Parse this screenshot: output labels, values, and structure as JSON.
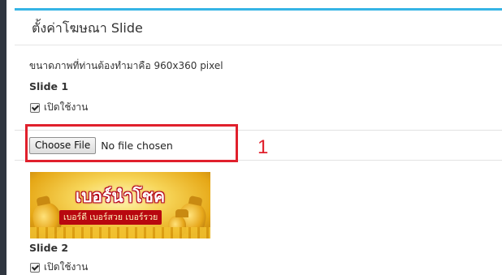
{
  "panel": {
    "title": "ตั้งค่าโฆษณา Slide",
    "size_hint": "ขนาดภาพที่ท่านต้องทำมาคือ 960x360 pixel"
  },
  "slides": [
    {
      "heading": "Slide 1",
      "enable_label": "เปิดใช้งาน",
      "enabled": true,
      "file_button_label": "Choose File",
      "file_status": "No file chosen",
      "banner": {
        "title": "เบอร์นำโชค",
        "subtitle": "เบอร์ดี เบอร์สวย เบอร์รวย"
      }
    },
    {
      "heading": "Slide 2",
      "enable_label": "เปิดใช้งาน",
      "enabled": true
    }
  ],
  "annotation": {
    "number": "1",
    "color": "#e0202c"
  },
  "colors": {
    "accent_top_border": "#36b4e5",
    "left_sidebar": "#2f3640"
  },
  "icons": {
    "checkbox": "checked-checkbox-icon"
  }
}
